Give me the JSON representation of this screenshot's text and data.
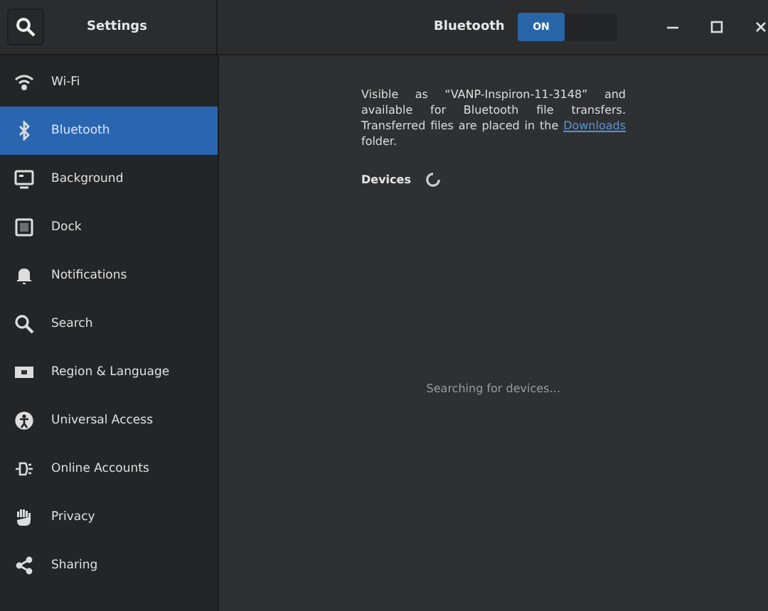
{
  "header": {
    "title": "Settings",
    "panel_title": "Bluetooth",
    "switch": {
      "label": "ON",
      "on": true
    }
  },
  "sidebar": {
    "items": [
      {
        "label": "Wi-Fi",
        "selected": false
      },
      {
        "label": "Bluetooth",
        "selected": true
      },
      {
        "label": "Background",
        "selected": false
      },
      {
        "label": "Dock",
        "selected": false
      },
      {
        "label": "Notifications",
        "selected": false
      },
      {
        "label": "Search",
        "selected": false
      },
      {
        "label": "Region & Language",
        "selected": false
      },
      {
        "label": "Universal Access",
        "selected": false
      },
      {
        "label": "Online Accounts",
        "selected": false
      },
      {
        "label": "Privacy",
        "selected": false
      },
      {
        "label": "Sharing",
        "selected": false
      }
    ]
  },
  "content": {
    "info_before": "Visible as “VANP-Inspiron-11-3148” and available for Bluetooth file transfers. Transferred files are placed in the",
    "info_link": "Downloads",
    "info_after": "folder.",
    "devices_heading": "Devices",
    "status": "Searching for devices…"
  }
}
